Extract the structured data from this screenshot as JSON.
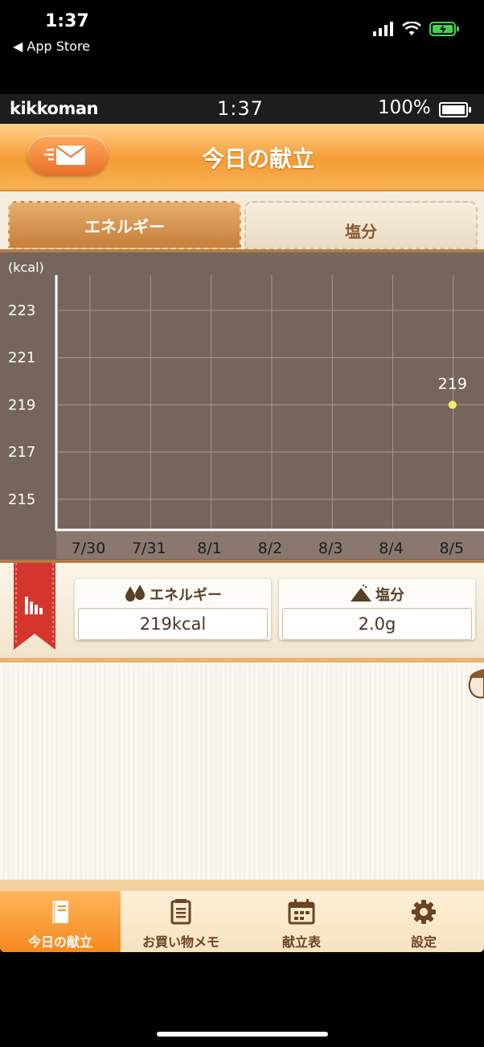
{
  "ios": {
    "time": "1:37",
    "back": "◀ App Store"
  },
  "app_status": {
    "brand": "kikkoman",
    "time": "1:37",
    "battery": "100%"
  },
  "header": {
    "title": "今日の献立"
  },
  "tabs": [
    {
      "label": "エネルギー",
      "active": true
    },
    {
      "label": "塩分",
      "active": false
    }
  ],
  "chart_data": {
    "type": "scatter",
    "ylabel": "(kcal)",
    "yticks": [
      223,
      221,
      219,
      217,
      215
    ],
    "ylim": [
      213.7,
      224.5
    ],
    "categories": [
      "7/30",
      "7/31",
      "8/1",
      "8/2",
      "8/3",
      "8/4",
      "8/5"
    ],
    "points": [
      {
        "x": "8/5",
        "y": 219,
        "label": "219"
      }
    ],
    "grid": true,
    "colors": {
      "background": "#75655d",
      "grid": "#a89890",
      "axis": "#ffffff",
      "point": "#f6ee6a",
      "text": "#ffffff",
      "ticks": "#1e1e1e"
    }
  },
  "stats": {
    "energy": {
      "label": "エネルギー",
      "value": "219kcal"
    },
    "salt": {
      "label": "塩分",
      "value": "2.0g"
    }
  },
  "tabbar": [
    {
      "label": "今日の献立",
      "icon": "notebook-icon",
      "active": true
    },
    {
      "label": "お買い物メモ",
      "icon": "memo-icon",
      "active": false
    },
    {
      "label": "献立表",
      "icon": "calendar-icon",
      "active": false
    },
    {
      "label": "設定",
      "icon": "gear-icon",
      "active": false
    }
  ],
  "colors": {
    "accent": "#f59c34",
    "brown": "#6b4424"
  }
}
